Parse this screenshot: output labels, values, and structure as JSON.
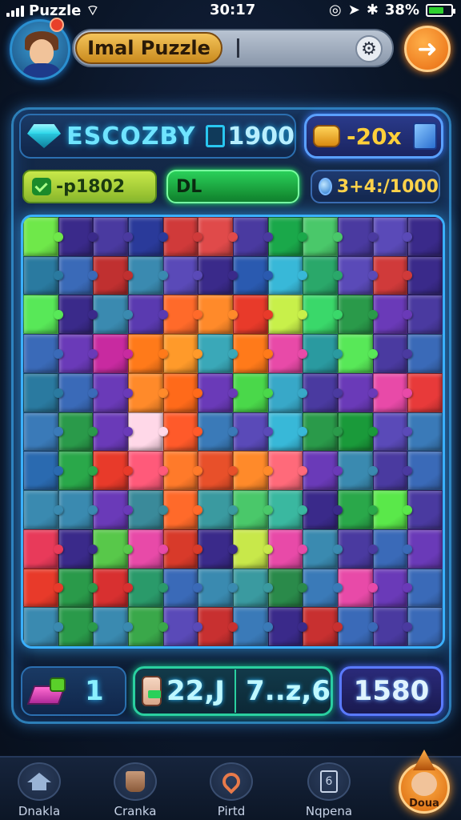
{
  "status_bar": {
    "carrier": "Puzzle",
    "time": "30:17",
    "battery": "38%"
  },
  "header": {
    "title": "Imal Puzzle",
    "search_caret": "|",
    "settings_icon": "gear-icon",
    "action_icon": "arrow-icon"
  },
  "scores": {
    "name": "ESCOZBY",
    "value": "1900",
    "multiplier": "-20x",
    "lives": "-p1802",
    "level": "DL",
    "gems": "3+4:/1000"
  },
  "board": {
    "columns": 12,
    "rows": 11,
    "tiles": [
      "#6fe84a",
      "#3a2a8a",
      "#4a3aa0",
      "#2a3a9a",
      "#d03a3a",
      "#e04a4a",
      "#4a3aa0",
      "#1aa84a",
      "#4ac86a",
      "#4a3aa0",
      "#5a4ab8",
      "#3a2a8a",
      "#2a7aa0",
      "#3a6ab8",
      "#c03030",
      "#3a8ab0",
      "#5a4ab8",
      "#3a2a8a",
      "#2a5ab0",
      "#38b8d8",
      "#2aa86a",
      "#5a4ab8",
      "#d03a3a",
      "#3a2a8a",
      "#58e858",
      "#3a2a8a",
      "#3a8ab0",
      "#5a3ab0",
      "#ff6a2a",
      "#ff8a2a",
      "#e83a2a",
      "#c8f04a",
      "#3ad86a",
      "#2a9a4a",
      "#6a3ab8",
      "#4a3aa0",
      "#3a6ab8",
      "#6a3ab8",
      "#c82aa0",
      "#ff7a1a",
      "#ff9a2a",
      "#3aa8b8",
      "#ff7a1a",
      "#e84aa8",
      "#2a9aa0",
      "#58e858",
      "#4a3aa0",
      "#3a6ab8",
      "#2a7aa0",
      "#3a6ab8",
      "#6a3ab8",
      "#ff8a2a",
      "#ff6a1a",
      "#6a3ab8",
      "#4ad84a",
      "#38a8c8",
      "#4a3aa0",
      "#6a3ab8",
      "#e84aa8",
      "#e83a3a",
      "#3a7ab8",
      "#2a9a4a",
      "#6a3ab8",
      "#ffd8e8",
      "#ff5a2a",
      "#3a7ab8",
      "#5a4ab8",
      "#38b8d8",
      "#2a9a4a",
      "#1a9a3a",
      "#5a4ab8",
      "#3a7ab8",
      "#2a6ab0",
      "#2aa84a",
      "#e83a2a",
      "#ff5a7a",
      "#ff7a2a",
      "#e8502a",
      "#ff8a2a",
      "#ff6a7a",
      "#6a3ab8",
      "#3a8ab0",
      "#4a3aa0",
      "#3a6ab8",
      "#3a8ab0",
      "#3a8ab0",
      "#6a3ab8",
      "#3a8a9a",
      "#ff6a2a",
      "#3a9aa0",
      "#4ac86a",
      "#3ab8a0",
      "#3a2a8a",
      "#2aa84a",
      "#5ae84a",
      "#4a3aa0",
      "#e83a5a",
      "#3a2a8a",
      "#58c84a",
      "#e84aa8",
      "#d83a2a",
      "#3a2a8a",
      "#c8e84a",
      "#e84aa8",
      "#3a8ab0",
      "#4a3aa0",
      "#3a6ab8",
      "#6a3ab8",
      "#e83a2a",
      "#2a9a4a",
      "#d83030",
      "#2a9a6a",
      "#3a6ab8",
      "#3a8ab0",
      "#3a9aa0",
      "#2a8a4a",
      "#3a7ab8",
      "#e84aa8",
      "#6a3ab8",
      "#3a6ab8",
      "#3a8ab0",
      "#2a9a4a",
      "#3a8ab0",
      "#3aa84a",
      "#5a4ab8",
      "#c83030",
      "#3a7ab8",
      "#3a2a8a",
      "#c83030",
      "#3a6ab8",
      "#4a3aa0",
      "#3a6ab8"
    ]
  },
  "stats": {
    "moves": "1",
    "time": "22,J",
    "progress": "7..z,6",
    "total": "1580"
  },
  "nav": {
    "items": [
      {
        "label": "Dnakla",
        "icon": "home-icon"
      },
      {
        "label": "Cranka",
        "icon": "cup-icon"
      },
      {
        "label": "Pirtd",
        "icon": "pin-icon"
      },
      {
        "label": "Nqpena",
        "icon": "document-icon",
        "glyph": "6"
      }
    ],
    "active_label": "Doua"
  }
}
